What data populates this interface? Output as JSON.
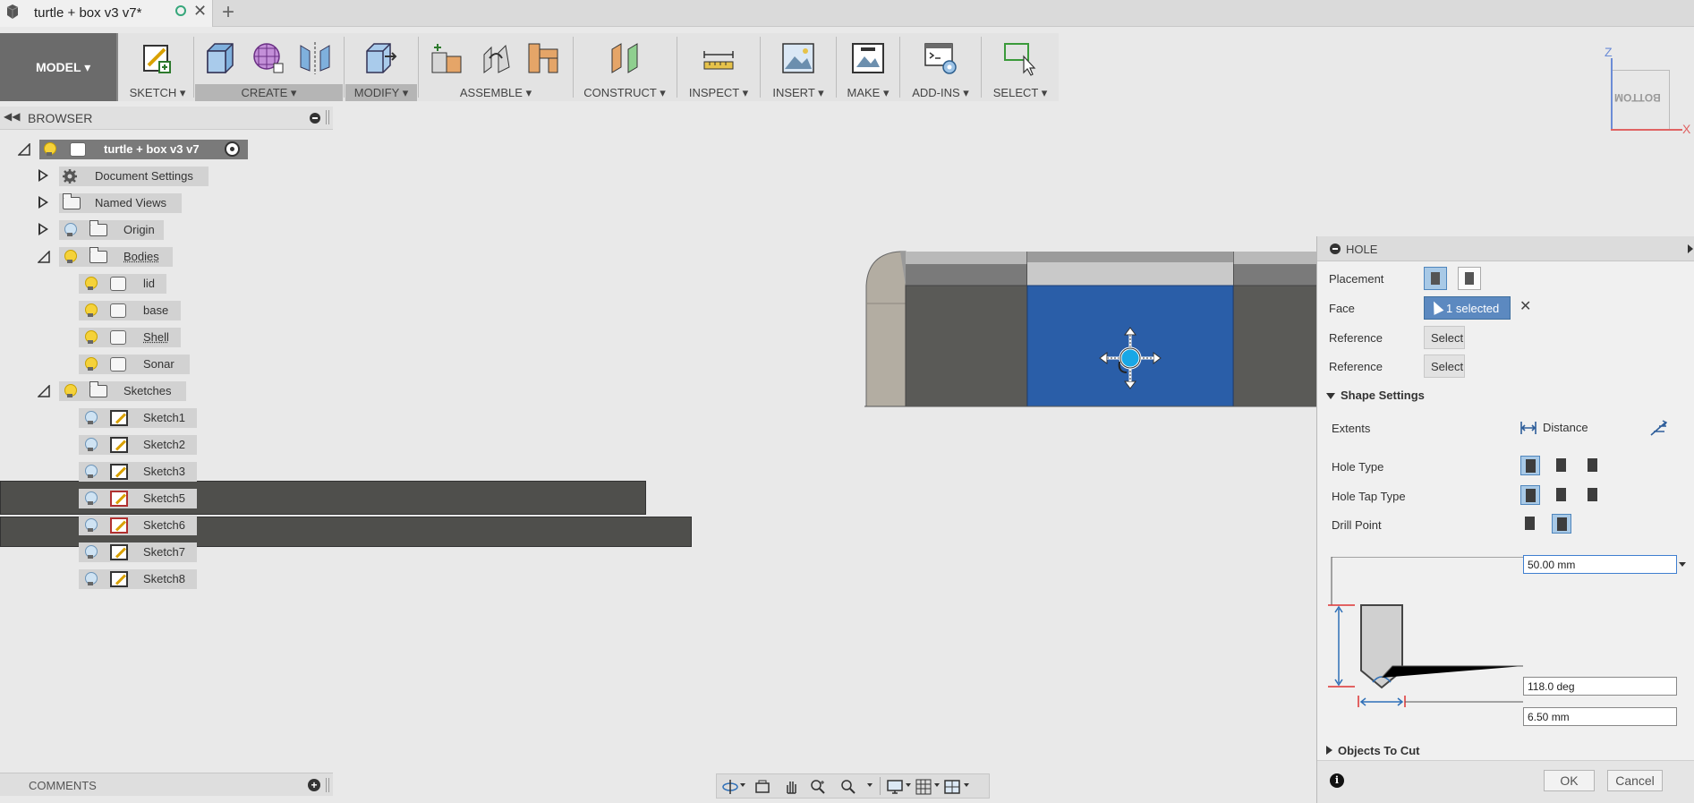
{
  "app": {
    "document_tab_title": "turtle + box v3 v7*"
  },
  "toolbar": {
    "workspace_label": "MODEL ▾",
    "groups": {
      "sketch": "SKETCH ▾",
      "create": "CREATE ▾",
      "modify": "MODIFY ▾",
      "assemble": "ASSEMBLE ▾",
      "construct": "CONSTRUCT ▾",
      "inspect": "INSPECT ▾",
      "insert": "INSERT ▾",
      "make": "MAKE ▾",
      "add_ins": "ADD-INS ▾",
      "select": "SELECT ▾"
    }
  },
  "browser": {
    "title": "BROWSER",
    "root_label": "turtle + box v3 v7",
    "items": {
      "document_settings": "Document Settings",
      "named_views": "Named Views",
      "origin": "Origin",
      "bodies": "Bodies",
      "lid": "lid",
      "base": "base",
      "shell": "Shell",
      "sonar": "Sonar",
      "sketches": "Sketches",
      "sketch1": "Sketch1",
      "sketch2": "Sketch2",
      "sketch3": "Sketch3",
      "sketch5": "Sketch5",
      "sketch6": "Sketch6",
      "sketch7": "Sketch7",
      "sketch8": "Sketch8"
    }
  },
  "viewcube": {
    "face_label": "BOTTOM",
    "axis_z": "Z",
    "axis_x": "X"
  },
  "hole_panel": {
    "title": "HOLE",
    "placement_label": "Placement",
    "face_label": "Face",
    "face_value": "1 selected",
    "reference1_label": "Reference",
    "reference1_button": "Select",
    "reference2_label": "Reference",
    "reference2_button": "Select",
    "shape_settings_label": "Shape Settings",
    "extents_label": "Extents",
    "extents_value": "Distance",
    "hole_type_label": "Hole Type",
    "hole_tap_type_label": "Hole Tap Type",
    "drill_point_label": "Drill Point",
    "depth_value": "50.00 mm",
    "angle_value": "118.0 deg",
    "diameter_value": "6.50 mm",
    "objects_to_cut_label": "Objects To Cut",
    "ok_label": "OK",
    "cancel_label": "Cancel"
  },
  "comments": {
    "title": "COMMENTS"
  },
  "colors": {
    "selected_face": "#2a5ea8",
    "toolbar_bg": "#e3e3e3",
    "accent_blue": "#5c89c0"
  }
}
